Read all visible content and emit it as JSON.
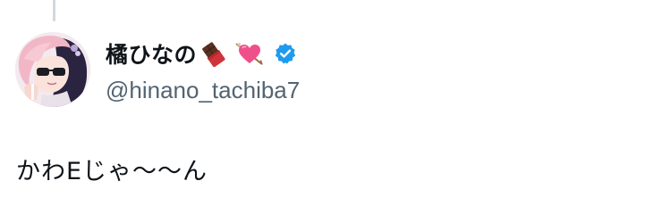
{
  "thread": {
    "has_connector_above": true
  },
  "author": {
    "display_name": "橘ひなの",
    "name_emojis": [
      "chocolate-bar-icon",
      "heart-with-arrow-icon"
    ],
    "verified": true,
    "verified_color": "#1d9bf0",
    "handle": "@hinano_tachiba7",
    "avatar": "avatar-anime-girl-pink-hair-sunglasses"
  },
  "tweet": {
    "text": "かわEじゃ〜〜ん"
  },
  "colors": {
    "text_primary": "#0f1419",
    "text_secondary": "#536471",
    "thread_line": "#cfd9de"
  }
}
